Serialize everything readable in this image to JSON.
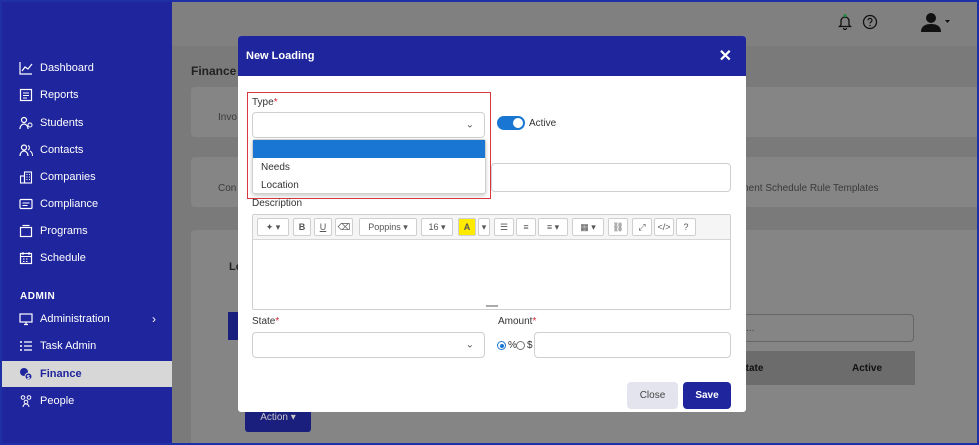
{
  "sidebar": {
    "items": [
      {
        "label": "Dashboard"
      },
      {
        "label": "Reports"
      },
      {
        "label": "Students"
      },
      {
        "label": "Contacts"
      },
      {
        "label": "Companies"
      },
      {
        "label": "Compliance"
      },
      {
        "label": "Programs"
      },
      {
        "label": "Schedule"
      }
    ],
    "admin_heading": "ADMIN",
    "admin_items": [
      {
        "label": "Administration"
      },
      {
        "label": "Task Admin"
      },
      {
        "label": "Finance"
      },
      {
        "label": "People"
      }
    ]
  },
  "background": {
    "page_title": "Finance",
    "tab_fragment_1": "Invo",
    "tab_fragment_2": "Con",
    "tab_right": "rment Schedule Rule Templates",
    "section_fragment": "Lo",
    "search_placeholder": "ng...",
    "table_headers": [
      "State",
      "Active"
    ],
    "action_label": "Action ▾"
  },
  "modal": {
    "title": "New Loading",
    "type_label": "Type",
    "type_options": [
      "",
      "Needs",
      "Location"
    ],
    "active_label": "Active",
    "description_label": "Description",
    "toolbar": {
      "font_name": "Poppins",
      "font_size": "16"
    },
    "state_label": "State",
    "amount_label": "Amount",
    "radio_percent": "%",
    "radio_dollar": "$",
    "close_label": "Close",
    "save_label": "Save"
  },
  "colors": {
    "primary": "#1f259c",
    "dropdown_selected": "#1976d2",
    "highlight": "#d8393e"
  }
}
